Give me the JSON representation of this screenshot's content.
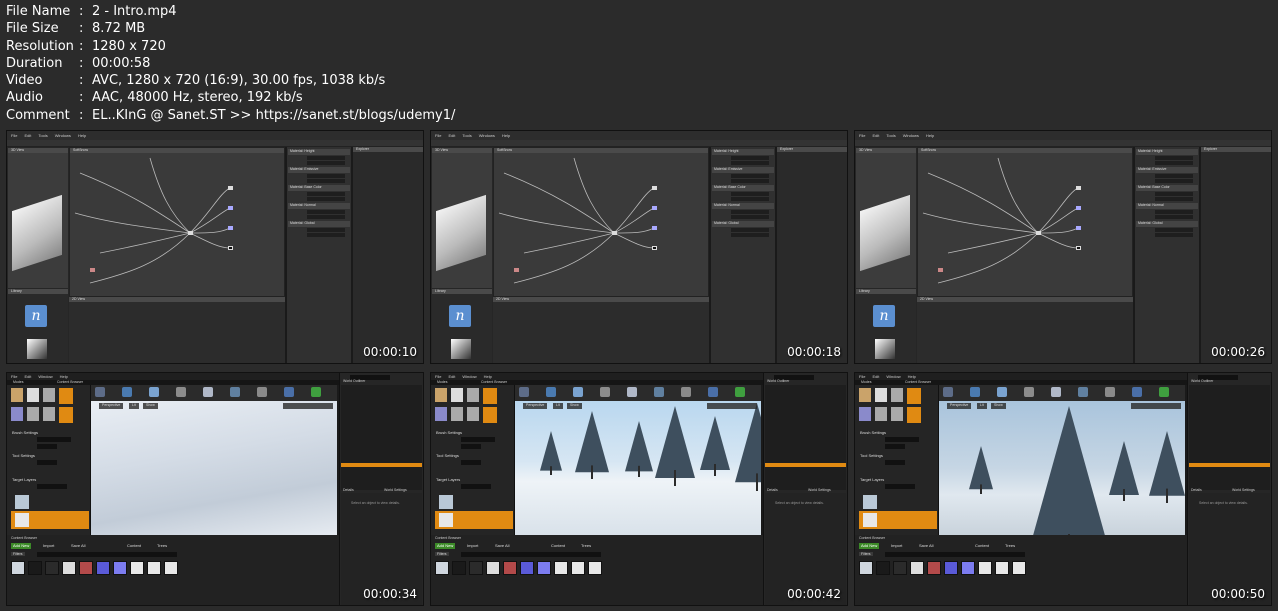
{
  "metadata": {
    "rows": [
      {
        "key": "File Name",
        "value": "2 - Intro.mp4"
      },
      {
        "key": "File Size",
        "value": "8.72 MB"
      },
      {
        "key": "Resolution",
        "value": "1280 x 720"
      },
      {
        "key": "Duration",
        "value": "00:00:58"
      },
      {
        "key": "Video",
        "value": "AVC, 1280 x 720 (16:9), 30.00 fps, 1038 kb/s"
      },
      {
        "key": "Audio",
        "value": "AAC, 48000 Hz, stereo, 192 kb/s"
      },
      {
        "key": "Comment",
        "value": "EL..KInG @ Sanet.ST >> https://sanet.st/blogs/udemy1/"
      }
    ],
    "separator": ":"
  },
  "thumbnails": [
    {
      "timestamp": "00:00:10",
      "app": "substance-designer"
    },
    {
      "timestamp": "00:00:18",
      "app": "substance-designer"
    },
    {
      "timestamp": "00:00:26",
      "app": "substance-designer"
    },
    {
      "timestamp": "00:00:34",
      "app": "unreal-editor",
      "scene": "snow-landscape"
    },
    {
      "timestamp": "00:00:42",
      "app": "unreal-editor",
      "scene": "snow-trees"
    },
    {
      "timestamp": "00:00:50",
      "app": "unreal-editor",
      "scene": "snow-tree-closeup"
    }
  ],
  "sd": {
    "menu": [
      "File",
      "Edit",
      "Tools",
      "Windows",
      "Help"
    ],
    "panel_3d": "3D View",
    "panel_graph": "SoftSnow",
    "panel_2d": "2D View",
    "panel_library": "Library",
    "panel_explorer": "Explorer",
    "props_sections": [
      "Material: Height",
      "Material: Emissive",
      "Material: Base Color",
      "Material: Normal",
      "Material: Global"
    ]
  },
  "ue": {
    "menu": [
      "File",
      "Edit",
      "Window",
      "Help"
    ],
    "modes_tab": "Modes",
    "content_browser_tab": "Content Browser",
    "brush_settings": "Brush Settings",
    "tool_settings": "Tool Settings",
    "target_layers": "Target Layers",
    "add_new": "Add New",
    "import": "Import",
    "save_all": "Save All",
    "breadcrumb": [
      "Content",
      "Trees"
    ],
    "filters": "Filters",
    "world_outliner": "World Outliner",
    "details": "Details",
    "world_settings": "World Settings",
    "details_hint": "Select an object to view details.",
    "viewport_mode": "Perspective",
    "lit": "Lit",
    "show": "Show"
  },
  "colors": {
    "accent_orange": "#e08a12",
    "add_new_green": "#3c8a28",
    "bg": "#2b2b2b"
  }
}
